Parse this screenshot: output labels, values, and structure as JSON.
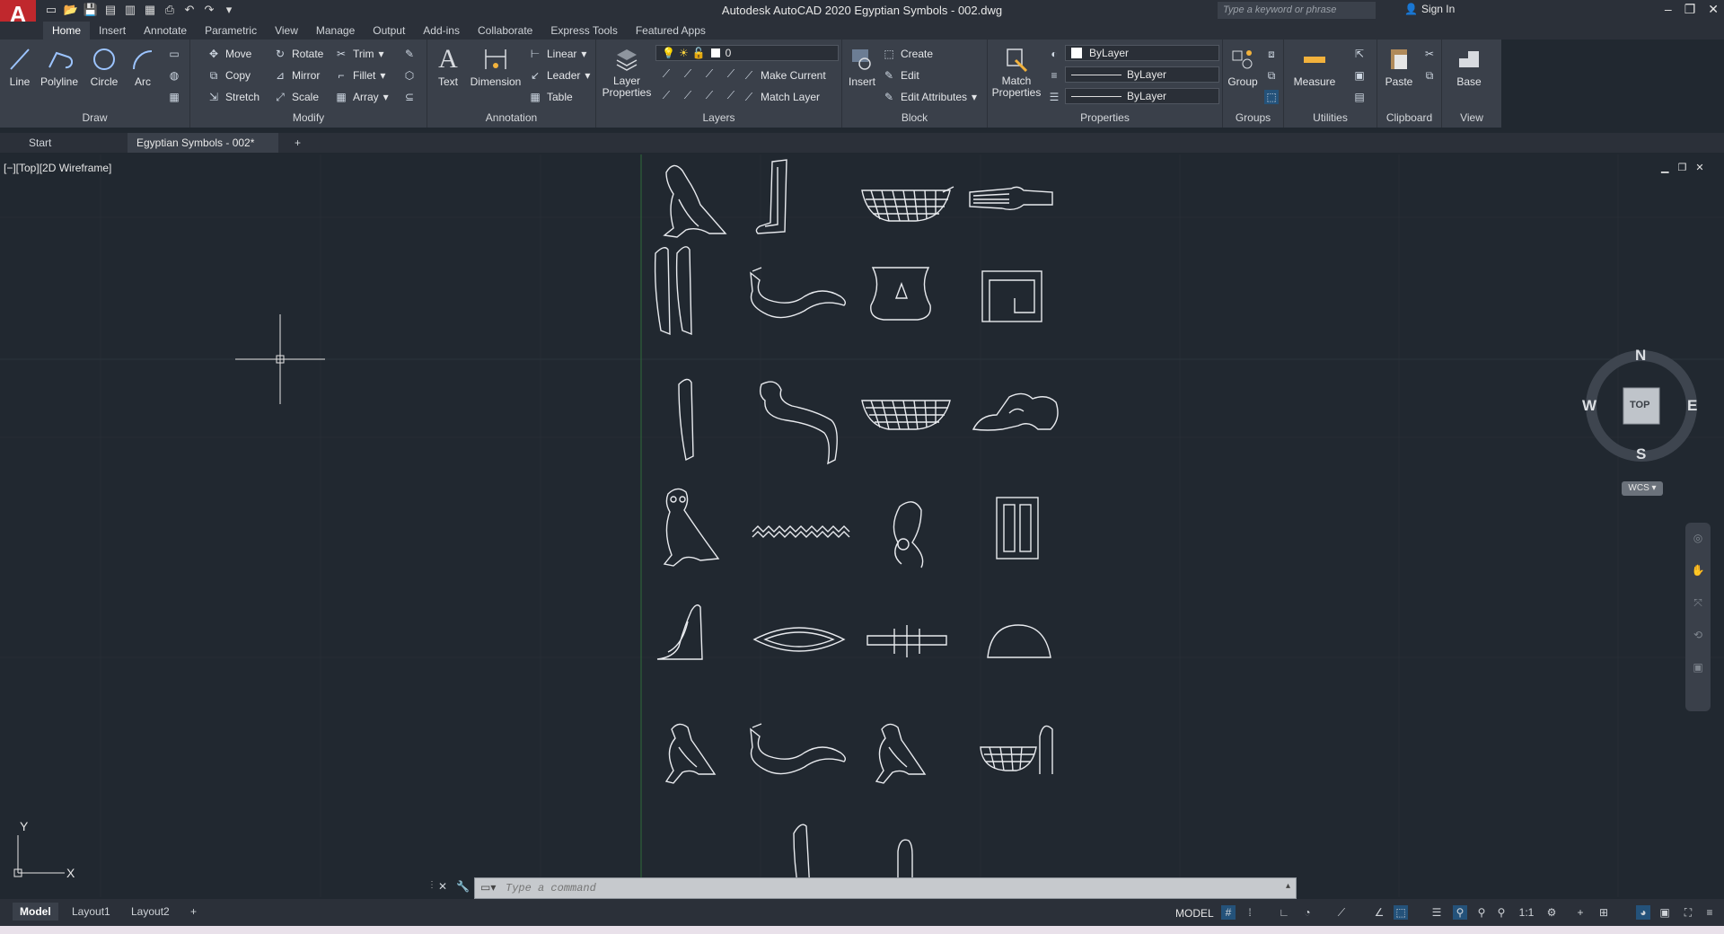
{
  "app": {
    "title": "Autodesk AutoCAD 2020   Egyptian Symbols - 002.dwg",
    "logo": "A"
  },
  "search": {
    "placeholder": "Type a keyword or phrase"
  },
  "account": {
    "signin": "Sign In"
  },
  "ribbon_tabs": [
    "Home",
    "Insert",
    "Annotate",
    "Parametric",
    "View",
    "Manage",
    "Output",
    "Add-ins",
    "Collaborate",
    "Express Tools",
    "Featured Apps"
  ],
  "draw": {
    "line": "Line",
    "polyline": "Polyline",
    "circle": "Circle",
    "arc": "Arc",
    "panel": "Draw"
  },
  "modify": {
    "move": "Move",
    "rotate": "Rotate",
    "trim": "Trim",
    "copy": "Copy",
    "mirror": "Mirror",
    "fillet": "Fillet",
    "stretch": "Stretch",
    "scale": "Scale",
    "array": "Array",
    "panel": "Modify"
  },
  "annotation": {
    "text": "Text",
    "dimension": "Dimension",
    "linear": "Linear",
    "leader": "Leader",
    "table": "Table",
    "panel": "Annotation"
  },
  "layers": {
    "properties": "Layer Properties",
    "current_layer": "0",
    "make_current": "Make Current",
    "match_layer": "Match Layer",
    "panel": "Layers"
  },
  "block": {
    "insert": "Insert",
    "create": "Create",
    "edit": "Edit",
    "edit_attributes": "Edit Attributes",
    "panel": "Block"
  },
  "properties": {
    "match": "Match Properties",
    "color": "ByLayer",
    "linetype": "ByLayer",
    "lineweight": "ByLayer",
    "panel": "Properties"
  },
  "groups": {
    "group": "Group",
    "panel": "Groups"
  },
  "utilities": {
    "measure": "Measure",
    "panel": "Utilities"
  },
  "clipboard": {
    "paste": "Paste",
    "panel": "Clipboard"
  },
  "view_panel": {
    "base": "Base",
    "panel": "View"
  },
  "doc_tabs": {
    "start": "Start",
    "file": "Egyptian Symbols - 002*"
  },
  "viewport": {
    "label": "[−][Top][2D Wireframe]"
  },
  "viewcube": {
    "n": "N",
    "s": "S",
    "e": "E",
    "w": "W",
    "top": "TOP",
    "wcs": "WCS"
  },
  "ucs": {
    "x": "X",
    "y": "Y"
  },
  "command": {
    "placeholder": "Type a command"
  },
  "layouts": [
    "Model",
    "Layout1",
    "Layout2"
  ],
  "status": {
    "model": "MODEL",
    "scale": "1:1"
  }
}
